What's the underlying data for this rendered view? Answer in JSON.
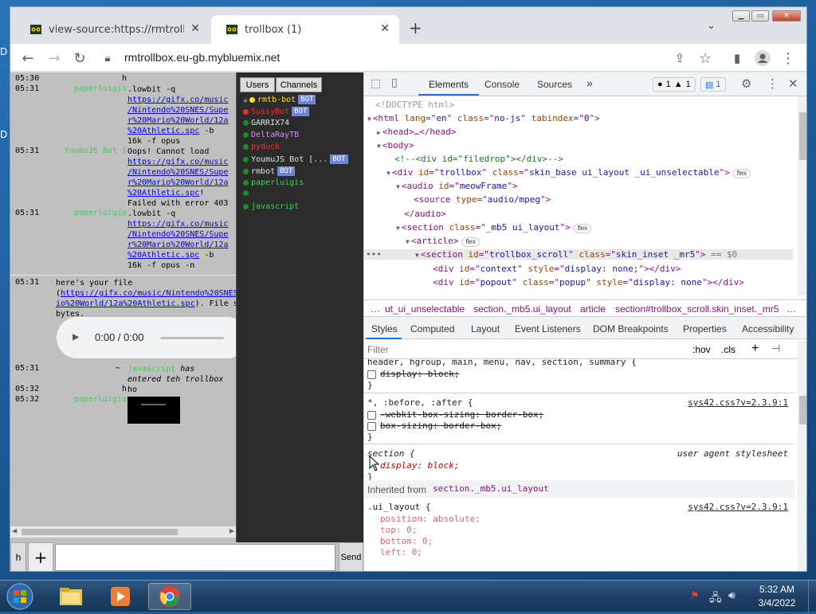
{
  "desktop": {
    "fragments": [
      "D",
      "D"
    ]
  },
  "browser": {
    "tabs": [
      {
        "title": "view-source:https://rmtrollbox.eu",
        "active": false
      },
      {
        "title": "trollbox (1)",
        "active": true
      }
    ],
    "url": "rmtrollbox.eu-gb.mybluemix.net"
  },
  "trollbox": {
    "messages": [
      {
        "time": "05:30",
        "nick": "h",
        "nick_color": "#000000",
        "lines": []
      },
      {
        "time": "05:31",
        "nick": "paperluigis",
        "nick_color": "#39d353",
        "lines": [
          {
            "t": ".lowbit -q",
            "link": false
          },
          {
            "t": "https://gifx.co/music",
            "link": true
          },
          {
            "t": "/Nintendo%20SNES/Supe",
            "link": true
          },
          {
            "t": "r%20Mario%20World/12a",
            "link": true
          },
          {
            "t": "%20Athletic.spc",
            "link": true,
            "suffix": " -b"
          },
          {
            "t": "16k -f opus",
            "link": false
          }
        ]
      },
      {
        "time": "05:31",
        "nick": "YoumuJS Bot [",
        "nick_color": "#39d353",
        "lines": [
          {
            "t": "Oops! Cannot load",
            "link": false
          },
          {
            "t": "https://gifx.co/music",
            "link": true
          },
          {
            "t": "/Nintendo%20SNES/Supe",
            "link": true
          },
          {
            "t": "r%20Mario%20World/12a",
            "link": true
          },
          {
            "t": "%20Athletic.spc",
            "link": true,
            "suffix": "!"
          },
          {
            "t": "Failed with error 403",
            "link": false
          }
        ]
      },
      {
        "time": "05:31",
        "nick": "paperluigis",
        "nick_color": "#39d353",
        "lines": [
          {
            "t": ".lowbit -q",
            "link": false
          },
          {
            "t": "https://gifx.co/music",
            "link": true
          },
          {
            "t": "/Nintendo%20SNES/Supe",
            "link": true
          },
          {
            "t": "r%20Mario%20World/12a",
            "link": true
          },
          {
            "t": "%20Athletic.spc",
            "link": true,
            "suffix": " -b"
          },
          {
            "t": "16k -f opus -n",
            "link": false
          }
        ]
      }
    ],
    "file_msg": {
      "time": "05:31",
      "line1": "here's your file",
      "line2_prefix": "(",
      "line2_link": "https://gifx.co/music/Nintendo%20SNES",
      "line3_link": "io%20World/12a%20Athletic.spc",
      "line3_suffix": "). File s",
      "line4": "bytes.",
      "audio_time": "0:00 / 0:00"
    },
    "join": {
      "time": "05:31",
      "dash": "~",
      "nick": "javascript",
      "text1": " has",
      "text2": "entered teh trollbox"
    },
    "m_h": {
      "time": "05:32",
      "nick": "h",
      "text": "ho"
    },
    "m_last": {
      "time": "05:32",
      "nick": "paperluigis"
    },
    "tabs": {
      "users": "Users",
      "channels": "Channels"
    },
    "users": [
      {
        "name": "rmtb-bot",
        "color": "#ffe600",
        "bot": true,
        "prefix": "☕",
        "dot": "#ffe600"
      },
      {
        "name": "SussyBot",
        "color": "#ff2a2a",
        "bot": true,
        "dot": "#ff2a2a"
      },
      {
        "name": "GARRIX74",
        "color": "#e0e0e0",
        "bot": false,
        "dot": "#1b8a2a"
      },
      {
        "name": "DeltaRayTB",
        "color": "#d08cff",
        "bot": false,
        "dot": "#1b8a2a"
      },
      {
        "name": "pyduck",
        "color": "#ff3030",
        "bot": false,
        "dot": "#1b8a2a"
      },
      {
        "name": "YoumuJS Bot [...",
        "color": "#e0e0e0",
        "bot": true,
        "dot": "#1b8a2a"
      },
      {
        "name": "rmbot",
        "color": "#e0e0e0",
        "bot": true,
        "dot": "#1b8a2a"
      },
      {
        "name": "paperluigis",
        "color": "#39d353",
        "bot": false,
        "dot": "#1b8a2a"
      },
      {
        "name": "",
        "color": "#e0e0e0",
        "bot": false,
        "dot": "#1b8a2a"
      },
      {
        "name": "javascript",
        "color": "#39d353",
        "bot": false,
        "dot": "#1b8a2a"
      }
    ],
    "bot_label": "BOT",
    "input": {
      "h": "h",
      "plus": "+",
      "send": "Send",
      "value": ""
    }
  },
  "devtools": {
    "tabs": [
      "Elements",
      "Console",
      "Sources"
    ],
    "more": "»",
    "badges": {
      "errors": "1",
      "warnings": "1",
      "messages": "1"
    },
    "dom": [
      {
        "i": 0,
        "html": "<!DOCTYPE html>",
        "cls": "cmnt"
      },
      {
        "i": 0,
        "tag": "html",
        "attrs": [
          [
            "lang",
            "en"
          ],
          [
            "class",
            "no-js"
          ],
          [
            "tabindex",
            "0"
          ]
        ]
      },
      {
        "i": 1,
        "raw": "<head>…</head>"
      },
      {
        "i": 1,
        "raw": "<body>"
      },
      {
        "i": 2,
        "comment": "<!--<div id=\"filedrop\"></div>-->"
      },
      {
        "i": 2,
        "tag": "div",
        "attrs": [
          [
            "id",
            "trollbox"
          ],
          [
            "class",
            "skin_base ui_layout _ui_unselectable"
          ]
        ],
        "flex": true
      },
      {
        "i": 3,
        "tag": "audio",
        "attrs": [
          [
            "id",
            "meowFrame"
          ]
        ]
      },
      {
        "i": 4,
        "tag": "source",
        "attrs": [
          [
            "type",
            "audio/mpeg"
          ]
        ]
      },
      {
        "i": 3,
        "raw": "</audio>"
      },
      {
        "i": 3,
        "tag": "section",
        "attrs": [
          [
            "class",
            "_mb5 ui_layout"
          ]
        ],
        "flex": true
      },
      {
        "i": 4,
        "raw": "<article>",
        "flex": true
      },
      {
        "i": 5,
        "tag": "section",
        "attrs": [
          [
            "id",
            "trollbox_scroll"
          ],
          [
            "class",
            "skin_inset _mr5"
          ]
        ],
        "sel": true,
        "after": " == $0"
      },
      {
        "i": 6,
        "tag": "div",
        "attrs": [
          [
            "id",
            "context"
          ],
          [
            "style",
            "display: none;"
          ]
        ],
        "close": "div"
      },
      {
        "i": 6,
        "tag": "div",
        "attrs": [
          [
            "id",
            "popout"
          ],
          [
            "class",
            "popup"
          ],
          [
            "style",
            "display: none"
          ]
        ],
        "close": "div"
      }
    ],
    "flex_label": "flex",
    "crumbs": [
      "…",
      "ut_ui_unselectable",
      "section._mb5.ui_layout",
      "article",
      "section#trollbox_scroll.skin_inset._mr5",
      "…"
    ],
    "subtabs": [
      "Styles",
      "Computed",
      "Layout",
      "Event Listeners",
      "DOM Breakpoints",
      "Properties",
      "Accessibility"
    ],
    "filter": {
      "placeholder": "Filter",
      "hov": ":hov",
      "cls": ".cls",
      "plus": "+"
    },
    "styles": {
      "r1_selector": "header, hgroup, main, menu, nav, section, summary {",
      "r1_prop": "display: block;",
      "r2_selector": "*, :before, :after {",
      "r2_src": "sys42.css?v=2.3.9:1",
      "r2_p1": "-webkit-box-sizing: border-box;",
      "r2_p2": "box-sizing: border-box;",
      "r3_selector": "section {",
      "r3_src": "user agent stylesheet",
      "r3_prop": "display: block;",
      "inherit_label": "Inherited from",
      "inherit_sel": "section._mb5.ui_layout",
      "r4_selector": ".ui_layout {",
      "r4_src": "sys42.css?v=2.3.9:1",
      "r4_props": [
        "position: absolute;",
        "top: 0;",
        "bottom: 0;",
        "left: 0;"
      ],
      "close": "}"
    }
  },
  "taskbar": {
    "time": "5:32 AM",
    "date": "3/4/2022"
  }
}
